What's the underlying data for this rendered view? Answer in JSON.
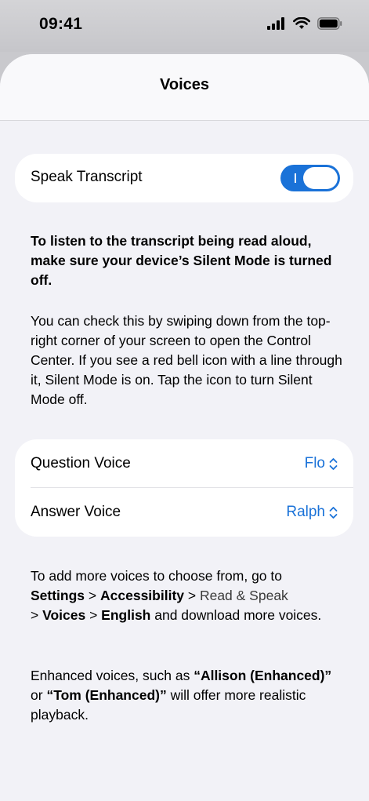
{
  "status_bar": {
    "time": "09:41"
  },
  "header": {
    "title": "Voices"
  },
  "speak_transcript": {
    "label": "Speak Transcript",
    "enabled": true
  },
  "info": {
    "warning": "To listen to the transcript being read aloud, make sure your device’s Silent Mode is turned off.",
    "explanation": "You can check this by swiping down from the top-right corner of your screen to open the Control Center. If you see a red bell icon with a line through it, Silent Mode is on. Tap the icon to turn Silent Mode off."
  },
  "voices": {
    "question": {
      "label": "Question Voice",
      "value": "Flo"
    },
    "answer": {
      "label": "Answer Voice",
      "value": "Ralph"
    }
  },
  "more_voices": {
    "intro": "To add more voices to choose from, go to",
    "settings": "Settings",
    "sep1": " > ",
    "accessibility": "Accessibility",
    "sep2": " > ",
    "read_speak": "Read & Speak",
    "sep3": "> ",
    "voices": "Voices",
    "sep4": " > ",
    "english": "English",
    "outro": " and download more voices."
  },
  "enhanced": {
    "intro": "Enhanced voices, such as ",
    "allison": "“Allison (Enhanced)”",
    "or": " or ",
    "tom": "“Tom (Enhanced)”",
    "outro": " will offer more realistic playback."
  },
  "colors": {
    "accent": "#1a72d8",
    "background": "#f2f2f7",
    "card": "#ffffff"
  }
}
